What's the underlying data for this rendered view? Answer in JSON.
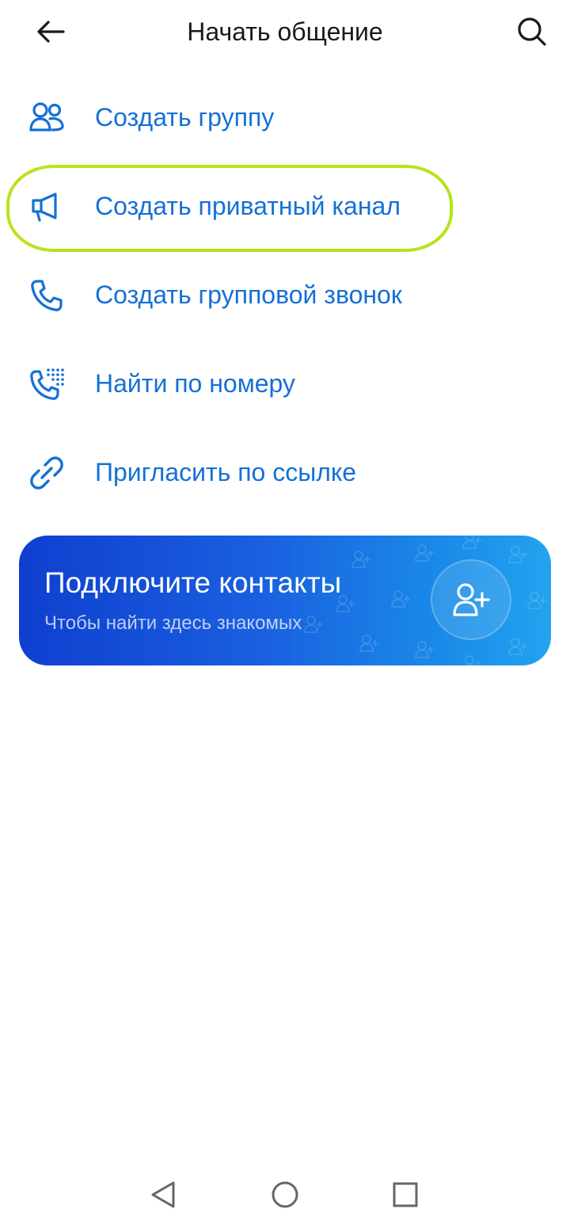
{
  "header": {
    "title": "Начать общение",
    "back_icon": "arrow-left-icon",
    "search_icon": "search-icon"
  },
  "menu": {
    "items": [
      {
        "label": "Создать группу",
        "icon": "group-users-icon"
      },
      {
        "label": "Создать приватный канал",
        "icon": "megaphone-icon"
      },
      {
        "label": "Создать групповой звонок",
        "icon": "phone-icon"
      },
      {
        "label": "Найти по номеру",
        "icon": "phone-keypad-icon"
      },
      {
        "label": "Пригласить по ссылке",
        "icon": "link-icon"
      }
    ]
  },
  "banner": {
    "title": "Подключите контакты",
    "subtitle": "Чтобы найти здесь знакомых",
    "button_icon": "add-user-icon"
  },
  "navbar": {
    "back_icon": "nav-back-triangle-icon",
    "home_icon": "nav-home-circle-icon",
    "recents_icon": "nav-recents-square-icon"
  },
  "colors": {
    "accent": "#1570d6",
    "highlight": "#b7e41c",
    "banner_start": "#0f3fcf",
    "banner_end": "#22a3ef"
  }
}
